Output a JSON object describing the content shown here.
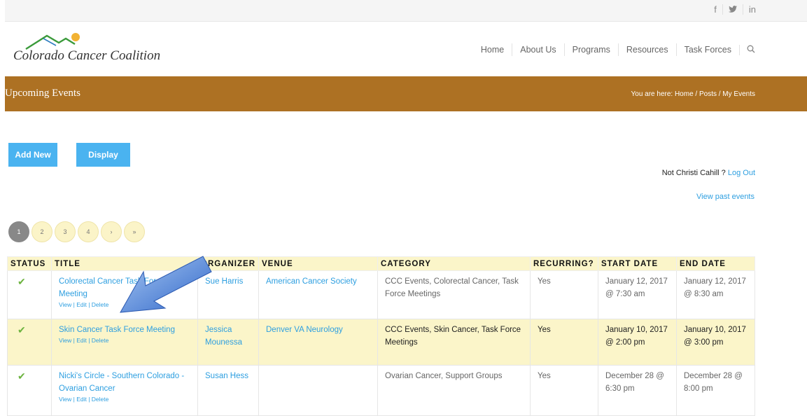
{
  "social": [
    "f",
    "y",
    "in"
  ],
  "logo": {
    "text": "Colorado Cancer Coalition"
  },
  "nav": [
    "Home",
    "About Us",
    "Programs",
    "Resources",
    "Task Forces"
  ],
  "banner": {
    "title": "Upcoming Events",
    "breadcrumb": "You are here:  Home  /  Posts  /  My Events"
  },
  "buttons": {
    "add_new": "Add New",
    "display": "Display"
  },
  "user": {
    "text": "Not Christi Cahill ? ",
    "logout": "Log Out"
  },
  "view_past": "View past events",
  "pagination": [
    "1",
    "2",
    "3",
    "4",
    "›",
    "»"
  ],
  "table": {
    "headers": [
      "STATUS",
      "TITLE",
      "ORGANIZER",
      "VENUE",
      "CATEGORY",
      "RECURRING?",
      "START DATE",
      "END DATE"
    ],
    "actions": "View | Edit | Delete",
    "rows": [
      {
        "title": "Colorectal Cancer Task Force Meeting",
        "organizer": "Sue Harris",
        "venue": "American Cancer Society",
        "category": "CCC Events, Colorectal Cancer, Task Force Meetings",
        "recurring": "Yes",
        "start": "January 12, 2017 @ 7:30 am",
        "end": "January 12, 2017 @ 8:30 am"
      },
      {
        "title": "Skin Cancer Task Force Meeting",
        "organizer": "Jessica Mounessa",
        "venue": "Denver VA Neurology",
        "category": "CCC Events, Skin Cancer, Task Force Meetings",
        "recurring": "Yes",
        "start": "January 10, 2017 @ 2:00 pm",
        "end": "January 10, 2017 @ 3:00 pm"
      },
      {
        "title": "Nicki's Circle - Southern Colorado - Ovarian Cancer",
        "organizer": "Susan Hess",
        "venue": "",
        "category": "Ovarian Cancer, Support Groups",
        "recurring": "Yes",
        "start": "December 28 @ 6:30 pm",
        "end": "December 28 @ 8:00 pm"
      }
    ]
  },
  "colors": {
    "banner": "#ad7123",
    "button": "#4ab3f0",
    "link": "#2e9fe0",
    "highlight": "#fbf5c9",
    "check": "#6cb33f"
  }
}
